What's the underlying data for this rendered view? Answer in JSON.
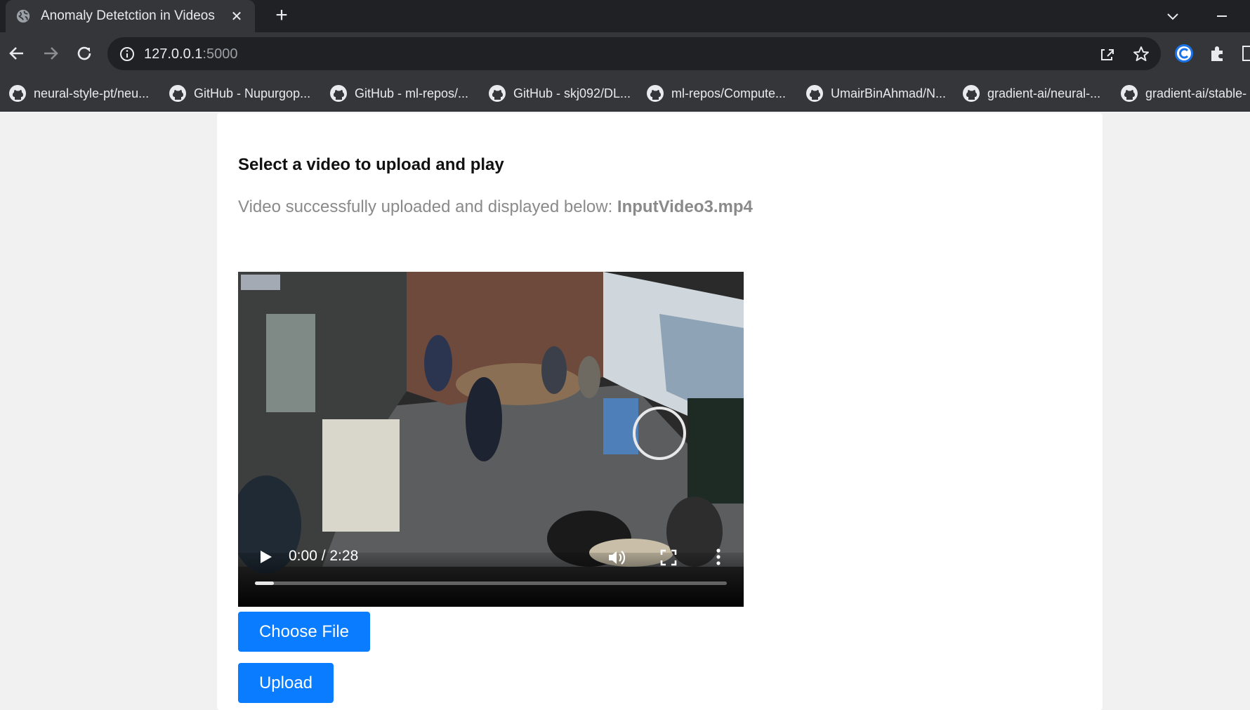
{
  "browser": {
    "tab_title": "Anomaly Detetction in Videos",
    "url_host": "127.0.0.1",
    "url_rest": ":5000",
    "bookmarks": [
      "neural-style-pt/neu...",
      "GitHub - Nupurgop...",
      "GitHub - ml-repos/...",
      "GitHub - skj092/DL...",
      "ml-repos/Compute...",
      "UmairBinAhmad/N...",
      "gradient-ai/neural-...",
      "gradient-ai/stable-"
    ],
    "icons": [
      "globe-icon",
      "close-icon",
      "plus-icon",
      "back-icon",
      "forward-icon",
      "reload-icon",
      "info-icon",
      "share-icon",
      "star-icon",
      "extension-icon",
      "github-icon"
    ],
    "colors": {
      "chrome_dark": "#202124",
      "chrome_mid": "#35363a",
      "text_light": "#e8eaed"
    }
  },
  "page": {
    "heading": "Select a video to upload and play",
    "status_prefix": "Video successfully uploaded and displayed below: ",
    "status_filename": "InputVideo3.mp4",
    "video": {
      "time_display": "0:00 / 2:28",
      "progress_fraction": 0.04
    },
    "choose_file_label": "Choose File",
    "upload_label": "Upload",
    "colors": {
      "button": "#0a7cff",
      "status_text": "#8a8a8a"
    }
  }
}
